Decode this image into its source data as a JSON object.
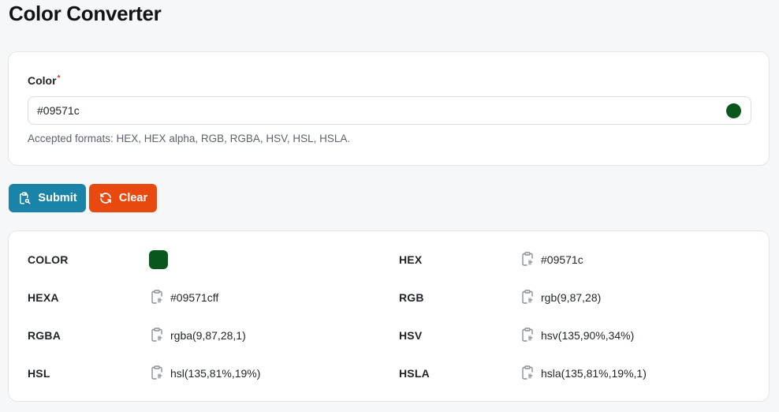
{
  "page": {
    "title": "Color Converter"
  },
  "form": {
    "label": "Color",
    "required_mark": "*",
    "value": "#09571c",
    "hint": "Accepted formats: HEX, HEX alpha, RGB, RGBA, HSV, HSL, HSLA.",
    "swatch_color": "#09571c"
  },
  "buttons": {
    "submit_label": "Submit",
    "submit_color": "#1a84a8",
    "clear_label": "Clear",
    "clear_color": "#e8490f"
  },
  "results": {
    "color_label": "COLOR",
    "swatch_color": "#09571c",
    "hex_label": "HEX",
    "hex_value": "#09571c",
    "hexa_label": "HEXA",
    "hexa_value": "#09571cff",
    "rgb_label": "RGB",
    "rgb_value": "rgb(9,87,28)",
    "rgba_label": "RGBA",
    "rgba_value": "rgba(9,87,28,1)",
    "hsv_label": "HSV",
    "hsv_value": "hsv(135,90%,34%)",
    "hsl_label": "HSL",
    "hsl_value": "hsl(135,81%,19%)",
    "hsla_label": "HSLA",
    "hsla_value": "hsla(135,81%,19%,1)",
    "copy_icon": "clipboard-icon"
  }
}
